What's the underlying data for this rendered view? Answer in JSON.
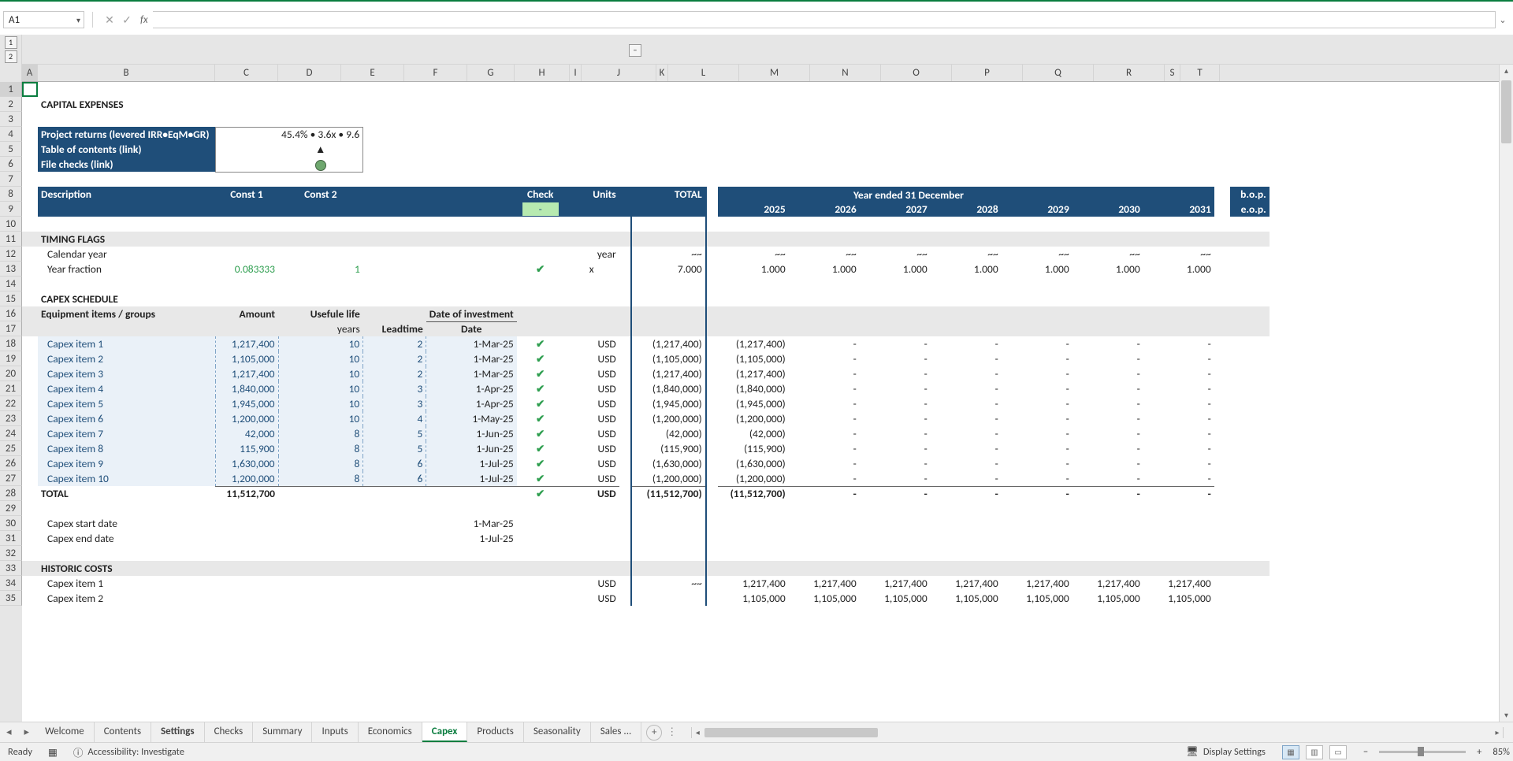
{
  "name_box": "A1",
  "title": "CAPITAL EXPENSES",
  "nav": {
    "returns_label": "Project returns (levered IRR•EqM•GR)",
    "returns_value": "45.4% • 3.6x • 9.6",
    "toc_label": "Table of contents (link)",
    "toc_value": "▲",
    "checks_label": "File checks (link)"
  },
  "header": {
    "description": "Description",
    "const1": "Const 1",
    "const2": "Const 2",
    "check": "Check",
    "units": "Units",
    "total": "TOTAL",
    "year_banner": "Year ended 31 December",
    "bop": "b.o.p.",
    "eop": "e.o.p.",
    "check_val": "-",
    "years": [
      "2025",
      "2026",
      "2027",
      "2028",
      "2029",
      "2030",
      "2031"
    ]
  },
  "sections": {
    "timing": "TIMING FLAGS",
    "capex_sched": "CAPEX SCHEDULE",
    "equip": "Equipment items / groups",
    "amount": "Amount",
    "useful": "Usefule life",
    "doi": "Date of investment",
    "years_u": "years",
    "leadtime": "Leadtime",
    "date": "Date",
    "total_label": "TOTAL",
    "historic": "HISTORIC COSTS",
    "capex_start": "Capex start date",
    "capex_end": "Capex end date"
  },
  "timing": {
    "cal_year": "Calendar year",
    "cal_units": "year",
    "cal_total": "~~",
    "cal_vals": [
      "~~",
      "~~",
      "~~",
      "~~",
      "~~",
      "~~",
      "~~"
    ],
    "year_frac": "Year fraction",
    "yf_c1": "0.083333",
    "yf_c2": "1",
    "yf_units": "x",
    "yf_total": "7.000",
    "yf_vals": [
      "1.000",
      "1.000",
      "1.000",
      "1.000",
      "1.000",
      "1.000",
      "1.000"
    ]
  },
  "capex": [
    {
      "name": "Capex item 1",
      "amount": "1,217,400",
      "life": "10",
      "lead": "2",
      "date": "1-Mar-25",
      "units": "USD",
      "total": "(1,217,400)",
      "y": [
        "(1,217,400)",
        "-",
        "-",
        "-",
        "-",
        "-",
        "-"
      ]
    },
    {
      "name": "Capex item 2",
      "amount": "1,105,000",
      "life": "10",
      "lead": "2",
      "date": "1-Mar-25",
      "units": "USD",
      "total": "(1,105,000)",
      "y": [
        "(1,105,000)",
        "-",
        "-",
        "-",
        "-",
        "-",
        "-"
      ]
    },
    {
      "name": "Capex item 3",
      "amount": "1,217,400",
      "life": "10",
      "lead": "2",
      "date": "1-Mar-25",
      "units": "USD",
      "total": "(1,217,400)",
      "y": [
        "(1,217,400)",
        "-",
        "-",
        "-",
        "-",
        "-",
        "-"
      ]
    },
    {
      "name": "Capex item 4",
      "amount": "1,840,000",
      "life": "10",
      "lead": "3",
      "date": "1-Apr-25",
      "units": "USD",
      "total": "(1,840,000)",
      "y": [
        "(1,840,000)",
        "-",
        "-",
        "-",
        "-",
        "-",
        "-"
      ]
    },
    {
      "name": "Capex item 5",
      "amount": "1,945,000",
      "life": "10",
      "lead": "3",
      "date": "1-Apr-25",
      "units": "USD",
      "total": "(1,945,000)",
      "y": [
        "(1,945,000)",
        "-",
        "-",
        "-",
        "-",
        "-",
        "-"
      ]
    },
    {
      "name": "Capex item 6",
      "amount": "1,200,000",
      "life": "10",
      "lead": "4",
      "date": "1-May-25",
      "units": "USD",
      "total": "(1,200,000)",
      "y": [
        "(1,200,000)",
        "-",
        "-",
        "-",
        "-",
        "-",
        "-"
      ]
    },
    {
      "name": "Capex item 7",
      "amount": "42,000",
      "life": "8",
      "lead": "5",
      "date": "1-Jun-25",
      "units": "USD",
      "total": "(42,000)",
      "y": [
        "(42,000)",
        "-",
        "-",
        "-",
        "-",
        "-",
        "-"
      ]
    },
    {
      "name": "Capex item 8",
      "amount": "115,900",
      "life": "8",
      "lead": "5",
      "date": "1-Jun-25",
      "units": "USD",
      "total": "(115,900)",
      "y": [
        "(115,900)",
        "-",
        "-",
        "-",
        "-",
        "-",
        "-"
      ]
    },
    {
      "name": "Capex item 9",
      "amount": "1,630,000",
      "life": "8",
      "lead": "6",
      "date": "1-Jul-25",
      "units": "USD",
      "total": "(1,630,000)",
      "y": [
        "(1,630,000)",
        "-",
        "-",
        "-",
        "-",
        "-",
        "-"
      ]
    },
    {
      "name": "Capex item 10",
      "amount": "1,200,000",
      "life": "8",
      "lead": "6",
      "date": "1-Jul-25",
      "units": "USD",
      "total": "(1,200,000)",
      "y": [
        "(1,200,000)",
        "-",
        "-",
        "-",
        "-",
        "-",
        "-"
      ]
    }
  ],
  "capex_total": {
    "amount": "11,512,700",
    "units": "USD",
    "total": "(11,512,700)",
    "y": [
      "(11,512,700)",
      "-",
      "-",
      "-",
      "-",
      "-",
      "-"
    ]
  },
  "capex_dates": {
    "start": "1-Mar-25",
    "end": "1-Jul-25"
  },
  "historic": [
    {
      "name": "Capex item 1",
      "units": "USD",
      "total": "~~",
      "y": [
        "1,217,400",
        "1,217,400",
        "1,217,400",
        "1,217,400",
        "1,217,400",
        "1,217,400",
        "1,217,400"
      ]
    },
    {
      "name": "Capex item 2",
      "units": "USD",
      "total": "",
      "y": [
        "1,105,000",
        "1,105,000",
        "1,105,000",
        "1,105,000",
        "1,105,000",
        "1,105,000",
        "1,105,000"
      ]
    }
  ],
  "columns": [
    "A",
    "B",
    "C",
    "D",
    "E",
    "F",
    "G",
    "H",
    "I",
    "J",
    "K",
    "L",
    "M",
    "N",
    "O",
    "P",
    "Q",
    "R",
    "S",
    "T"
  ],
  "tabs": [
    "Welcome",
    "Contents",
    "Settings",
    "Checks",
    "Summary",
    "Inputs",
    "Economics",
    "Capex",
    "Products",
    "Seasonality",
    "Sales ..."
  ],
  "active_tab": "Capex",
  "bold_tabs": [
    "Settings"
  ],
  "status": {
    "ready": "Ready",
    "acc": "Accessibility: Investigate",
    "display": "Display Settings",
    "zoom": "85%"
  },
  "col_widths": {
    "A": 20,
    "B": 225,
    "C": 80,
    "D": 80,
    "E": 80,
    "F": 80,
    "G": 60,
    "H": 70,
    "I": 15,
    "J": 95,
    "K": 15,
    "L": 90,
    "M": 90,
    "N": 90,
    "O": 90,
    "P": 90,
    "Q": 90,
    "R": 90,
    "S": 20,
    "T": 50
  }
}
